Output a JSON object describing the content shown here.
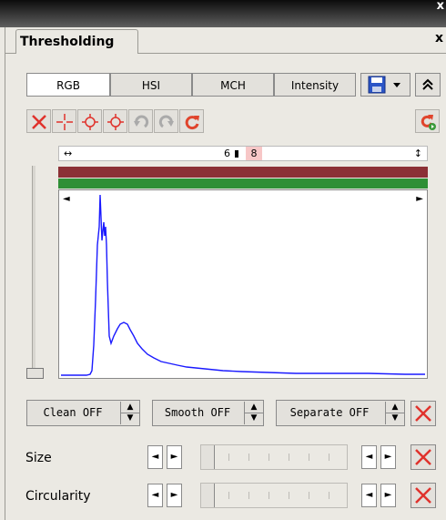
{
  "window": {
    "close_glyph": "x"
  },
  "panel": {
    "tab_title": "Thresholding",
    "tab_close": "x"
  },
  "modes": [
    {
      "label": "RGB",
      "active": true
    },
    {
      "label": "HSI",
      "active": false
    },
    {
      "label": "MCH",
      "active": false
    },
    {
      "label": "Intensity",
      "active": false
    }
  ],
  "toolbar": {
    "icons": [
      "clear-icon",
      "crosshair-icon",
      "target-icon",
      "target-add-icon",
      "undo-icon",
      "redo-icon",
      "refresh-icon"
    ],
    "apply_icon": "apply-refresh-icon",
    "save_icon": "save-disk-icon",
    "collapse_glyph": "»"
  },
  "range": {
    "left_glyph": "↔",
    "low": "6",
    "high": "8",
    "right_glyph": "↕"
  },
  "histogram": {
    "left_marker": "◄",
    "right_marker": "►",
    "colors": {
      "red_band": "#8b3036",
      "green_band": "#2f8f36",
      "curve": "#1a1aff"
    }
  },
  "controls": [
    {
      "label": "Clean OFF"
    },
    {
      "label": "Smooth OFF"
    },
    {
      "label": "Separate OFF"
    }
  ],
  "spinner": {
    "up": "▲",
    "down": "▼"
  },
  "filters": [
    {
      "label": "Size"
    },
    {
      "label": "Circularity"
    }
  ],
  "arrows": {
    "left": "◄",
    "right": "►"
  }
}
